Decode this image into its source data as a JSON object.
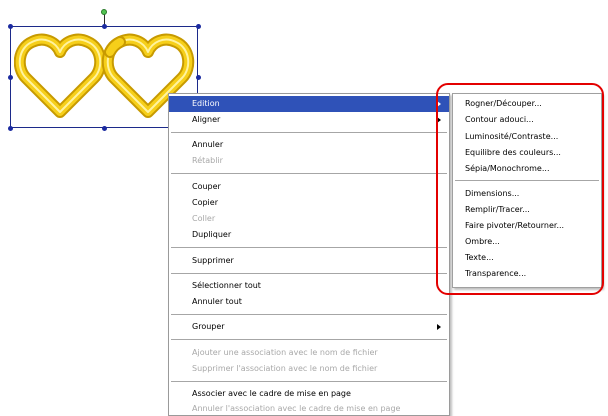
{
  "main_menu": {
    "edition": "Edition",
    "aligner": "Aligner",
    "annuler": "Annuler",
    "retablir": "Rétablir",
    "couper": "Couper",
    "copier": "Copier",
    "coller": "Coller",
    "dupliquer": "Dupliquer",
    "supprimer": "Supprimer",
    "selectionner_tout": "Sélectionner tout",
    "annuler_tout": "Annuler tout",
    "grouper": "Grouper",
    "ajouter_association": "Ajouter une association avec le nom de fichier",
    "supprimer_association": "Supprimer l'association avec le nom de fichier",
    "associer_cadre": "Associer avec le cadre de mise en page",
    "annuler_association_cadre": "Annuler l'association avec le cadre de mise en page"
  },
  "submenu": {
    "rogner": "Rogner/Découper...",
    "contour": "Contour adouci...",
    "luminosite": "Luminosité/Contraste...",
    "equilibre": "Equilibre des couleurs...",
    "sepia": "Sépia/Monochrome...",
    "dimensions": "Dimensions...",
    "remplir": "Remplir/Tracer...",
    "faire_pivoter": "Faire pivoter/Retourner...",
    "ombre": "Ombre...",
    "texte": "Texte...",
    "transparence": "Transparence..."
  },
  "colors": {
    "highlight": "#2f52b8",
    "outline": "#e30000",
    "hearts": "#f2c200"
  }
}
